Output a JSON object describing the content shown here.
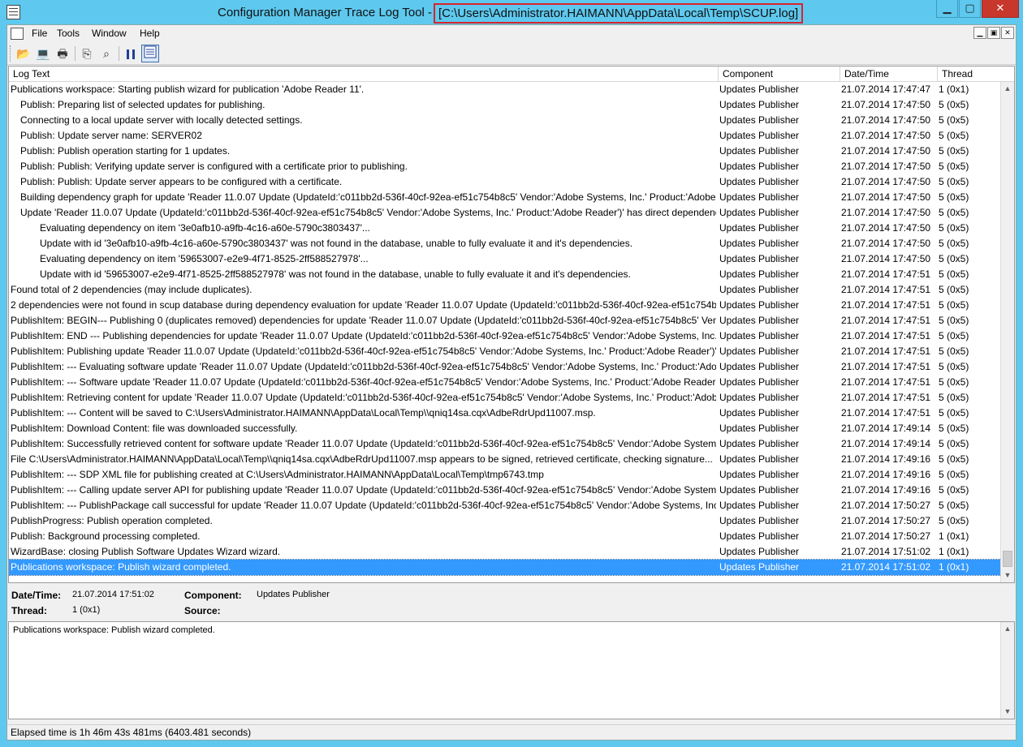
{
  "window": {
    "title": "Configuration Manager Trace Log Tool -",
    "path": "[C:\\Users\\Administrator.HAIMANN\\AppData\\Local\\Temp\\SCUP.log]",
    "btn_min": "▁",
    "btn_max": "▢",
    "btn_close": "✕"
  },
  "menu": [
    "File",
    "Tools",
    "Window",
    "Help"
  ],
  "mdi_buttons": [
    "▁",
    "▣",
    "✕"
  ],
  "toolbar": {
    "open": "📂",
    "print_setup": "💻",
    "print": "🖶",
    "copy": "⎘",
    "find": "⌕"
  },
  "columns": {
    "text": "Log Text",
    "component": "Component",
    "datetime": "Date/Time",
    "thread": "Thread"
  },
  "rows": [
    {
      "text": "Publications workspace: Starting publish wizard for publication 'Adobe Reader 11'.",
      "indent": 0,
      "component": "Updates Publisher",
      "datetime": "21.07.2014 17:47:47",
      "thread": "1 (0x1)"
    },
    {
      "text": "Publish: Preparing list of selected updates for publishing.",
      "indent": 1,
      "component": "Updates Publisher",
      "datetime": "21.07.2014 17:47:50",
      "thread": "5 (0x5)"
    },
    {
      "text": "Connecting to a local update server with locally detected settings.",
      "indent": 1,
      "component": "Updates Publisher",
      "datetime": "21.07.2014 17:47:50",
      "thread": "5 (0x5)"
    },
    {
      "text": "Publish: Update server name: SERVER02",
      "indent": 1,
      "component": "Updates Publisher",
      "datetime": "21.07.2014 17:47:50",
      "thread": "5 (0x5)"
    },
    {
      "text": "Publish: Publish operation starting for 1 updates.",
      "indent": 1,
      "component": "Updates Publisher",
      "datetime": "21.07.2014 17:47:50",
      "thread": "5 (0x5)"
    },
    {
      "text": "Publish: Publish: Verifying update server is configured with a certificate prior to publishing.",
      "indent": 1,
      "component": "Updates Publisher",
      "datetime": "21.07.2014 17:47:50",
      "thread": "5 (0x5)"
    },
    {
      "text": "Publish: Publish: Update server appears to be configured with a certificate.",
      "indent": 1,
      "component": "Updates Publisher",
      "datetime": "21.07.2014 17:47:50",
      "thread": "5 (0x5)"
    },
    {
      "text": "Building dependency graph for update 'Reader 11.0.07 Update (UpdateId:'c011bb2d-536f-40cf-92ea-ef51c754b8c5' Vendor:'Adobe Systems, Inc.' Product:'Adobe ...",
      "indent": 1,
      "component": "Updates Publisher",
      "datetime": "21.07.2014 17:47:50",
      "thread": "5 (0x5)"
    },
    {
      "text": "Update 'Reader 11.0.07 Update (UpdateId:'c011bb2d-536f-40cf-92ea-ef51c754b8c5' Vendor:'Adobe Systems, Inc.' Product:'Adobe Reader')' has direct dependenc...c",
      "indent": 1,
      "component": "Updates Publisher",
      "datetime": "21.07.2014 17:47:50",
      "thread": "5 (0x5)"
    },
    {
      "text": "Evaluating dependency on item '3e0afb10-a9fb-4c16-a60e-5790c3803437'...",
      "indent": 2,
      "component": "Updates Publisher",
      "datetime": "21.07.2014 17:47:50",
      "thread": "5 (0x5)"
    },
    {
      "text": "Update with id '3e0afb10-a9fb-4c16-a60e-5790c3803437' was not found in the database, unable to fully evaluate it and it's dependencies.",
      "indent": 2,
      "component": "Updates Publisher",
      "datetime": "21.07.2014 17:47:50",
      "thread": "5 (0x5)"
    },
    {
      "text": "Evaluating dependency on item '59653007-e2e9-4f71-8525-2ff588527978'...",
      "indent": 2,
      "component": "Updates Publisher",
      "datetime": "21.07.2014 17:47:50",
      "thread": "5 (0x5)"
    },
    {
      "text": "Update with id '59653007-e2e9-4f71-8525-2ff588527978' was not found in the database, unable to fully evaluate it and it's dependencies.",
      "indent": 2,
      "component": "Updates Publisher",
      "datetime": "21.07.2014 17:47:51",
      "thread": "5 (0x5)"
    },
    {
      "text": "Found total of 2 dependencies (may include duplicates).",
      "indent": 0,
      "component": "Updates Publisher",
      "datetime": "21.07.2014 17:47:51",
      "thread": "5 (0x5)"
    },
    {
      "text": "2 dependencies were not found in scup database during dependency evaluation for update 'Reader 11.0.07 Update (UpdateId:'c011bb2d-536f-40cf-92ea-ef51c754b...",
      "indent": 0,
      "component": "Updates Publisher",
      "datetime": "21.07.2014 17:47:51",
      "thread": "5 (0x5)"
    },
    {
      "text": "PublishItem: BEGIN--- Publishing 0 (duplicates removed) dependencies for update 'Reader 11.0.07 Update (UpdateId:'c011bb2d-536f-40cf-92ea-ef51c754b8c5' Ven...",
      "indent": 0,
      "component": "Updates Publisher",
      "datetime": "21.07.2014 17:47:51",
      "thread": "5 (0x5)"
    },
    {
      "text": "PublishItem: END --- Publishing dependencies for update 'Reader 11.0.07 Update (UpdateId:'c011bb2d-536f-40cf-92ea-ef51c754b8c5' Vendor:'Adobe Systems, Inc.' ...",
      "indent": 0,
      "component": "Updates Publisher",
      "datetime": "21.07.2014 17:47:51",
      "thread": "5 (0x5)"
    },
    {
      "text": "PublishItem: Publishing update 'Reader 11.0.07 Update (UpdateId:'c011bb2d-536f-40cf-92ea-ef51c754b8c5' Vendor:'Adobe Systems, Inc.' Product:'Adobe Reader')'.",
      "indent": 0,
      "component": "Updates Publisher",
      "datetime": "21.07.2014 17:47:51",
      "thread": "5 (0x5)"
    },
    {
      "text": "PublishItem: --- Evaluating software update 'Reader 11.0.07 Update (UpdateId:'c011bb2d-536f-40cf-92ea-ef51c754b8c5' Vendor:'Adobe Systems, Inc.' Product:'Ado...",
      "indent": 0,
      "component": "Updates Publisher",
      "datetime": "21.07.2014 17:47:51",
      "thread": "5 (0x5)"
    },
    {
      "text": "PublishItem: --- Software update 'Reader 11.0.07 Update (UpdateId:'c011bb2d-536f-40cf-92ea-ef51c754b8c5' Vendor:'Adobe Systems, Inc.' Product:'Adobe Reader')'...",
      "indent": 0,
      "component": "Updates Publisher",
      "datetime": "21.07.2014 17:47:51",
      "thread": "5 (0x5)"
    },
    {
      "text": "PublishItem: Retrieving content for update 'Reader 11.0.07 Update (UpdateId:'c011bb2d-536f-40cf-92ea-ef51c754b8c5' Vendor:'Adobe Systems, Inc.' Product:'Adob...",
      "indent": 0,
      "component": "Updates Publisher",
      "datetime": "21.07.2014 17:47:51",
      "thread": "5 (0x5)"
    },
    {
      "text": "PublishItem: --- Content will be saved to C:\\Users\\Administrator.HAIMANN\\AppData\\Local\\Temp\\\\qniq14sa.cqx\\AdbeRdrUpd11007.msp.",
      "indent": 0,
      "component": "Updates Publisher",
      "datetime": "21.07.2014 17:47:51",
      "thread": "5 (0x5)"
    },
    {
      "text": "PublishItem: Download Content: file was downloaded successfully.",
      "indent": 0,
      "component": "Updates Publisher",
      "datetime": "21.07.2014 17:49:14",
      "thread": "5 (0x5)"
    },
    {
      "text": "PublishItem: Successfully retrieved content for software update 'Reader 11.0.07 Update (UpdateId:'c011bb2d-536f-40cf-92ea-ef51c754b8c5' Vendor:'Adobe Systems...",
      "indent": 0,
      "component": "Updates Publisher",
      "datetime": "21.07.2014 17:49:14",
      "thread": "5 (0x5)"
    },
    {
      "text": "File C:\\Users\\Administrator.HAIMANN\\AppData\\Local\\Temp\\\\qniq14sa.cqx\\AdbeRdrUpd11007.msp appears to be signed, retrieved certificate, checking signature...",
      "indent": 0,
      "component": "Updates Publisher",
      "datetime": "21.07.2014 17:49:16",
      "thread": "5 (0x5)"
    },
    {
      "text": "PublishItem: --- SDP XML file for publishing created at C:\\Users\\Administrator.HAIMANN\\AppData\\Local\\Temp\\tmp6743.tmp",
      "indent": 0,
      "component": "Updates Publisher",
      "datetime": "21.07.2014 17:49:16",
      "thread": "5 (0x5)"
    },
    {
      "text": "PublishItem: --- Calling update server API for publishing update 'Reader 11.0.07 Update (UpdateId:'c011bb2d-536f-40cf-92ea-ef51c754b8c5' Vendor:'Adobe System...",
      "indent": 0,
      "component": "Updates Publisher",
      "datetime": "21.07.2014 17:49:16",
      "thread": "5 (0x5)"
    },
    {
      "text": "PublishItem: --- PublishPackage call successful for update 'Reader 11.0.07 Update (UpdateId:'c011bb2d-536f-40cf-92ea-ef51c754b8c5' Vendor:'Adobe Systems, Inc.'...",
      "indent": 0,
      "component": "Updates Publisher",
      "datetime": "21.07.2014 17:50:27",
      "thread": "5 (0x5)"
    },
    {
      "text": "PublishProgress: Publish operation completed.",
      "indent": 0,
      "component": "Updates Publisher",
      "datetime": "21.07.2014 17:50:27",
      "thread": "5 (0x5)"
    },
    {
      "text": "Publish: Background processing completed.",
      "indent": 0,
      "component": "Updates Publisher",
      "datetime": "21.07.2014 17:50:27",
      "thread": "1 (0x1)"
    },
    {
      "text": "WizardBase: closing Publish Software Updates Wizard wizard.",
      "indent": 0,
      "component": "Updates Publisher",
      "datetime": "21.07.2014 17:51:02",
      "thread": "1 (0x1)"
    },
    {
      "text": "Publications workspace: Publish wizard completed.",
      "indent": 0,
      "component": "Updates Publisher",
      "datetime": "21.07.2014 17:51:02",
      "thread": "1 (0x1)",
      "selected": true
    }
  ],
  "details": {
    "datetime_label": "Date/Time:",
    "datetime_value": "21.07.2014 17:51:02",
    "component_label": "Component:",
    "component_value": "Updates Publisher",
    "thread_label": "Thread:",
    "thread_value": "1 (0x1)",
    "source_label": "Source:",
    "source_value": ""
  },
  "message": "Publications workspace: Publish wizard completed.",
  "status": "Elapsed time is 1h 46m 43s 481ms (6403.481 seconds)",
  "scroll": {
    "up": "▲",
    "down": "▼"
  }
}
